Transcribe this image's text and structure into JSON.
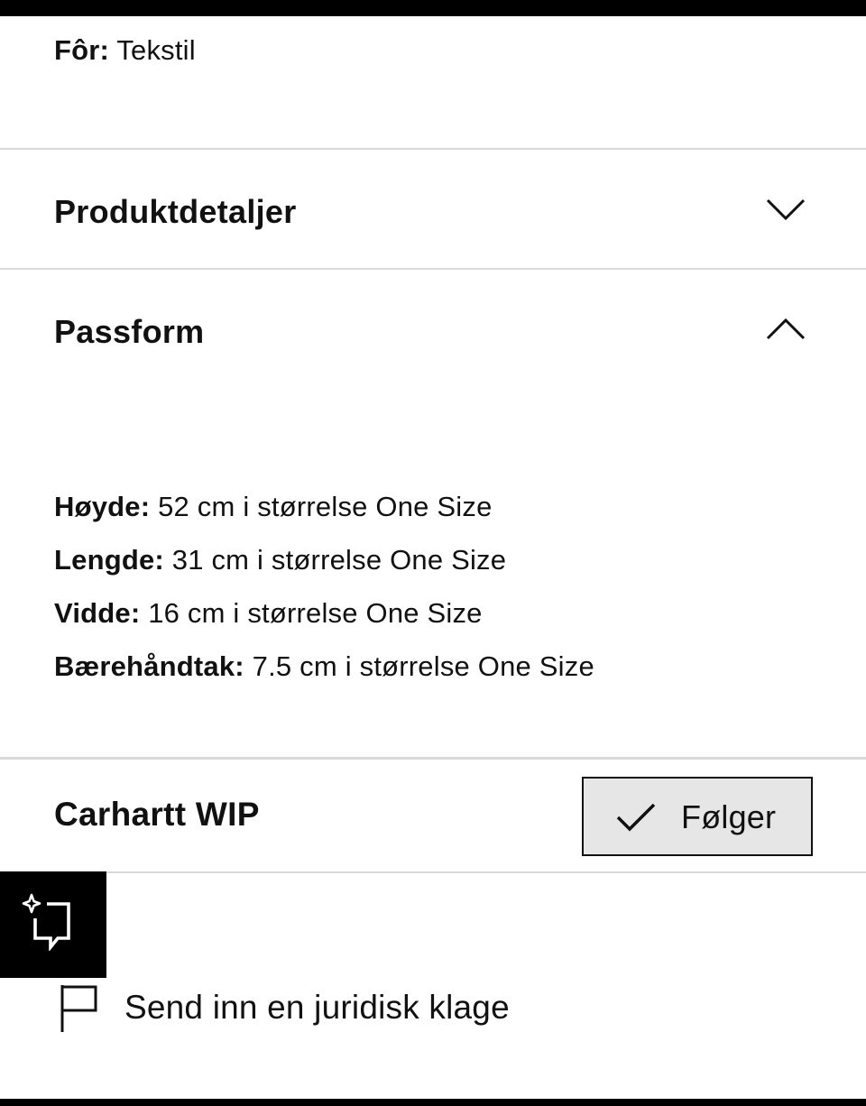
{
  "material": {
    "label": "Fôr:",
    "value": "Tekstil"
  },
  "accordion": {
    "product_details": {
      "title": "Produktdetaljer",
      "state": "collapsed",
      "icon": "chevron-down-icon"
    },
    "fit": {
      "title": "Passform",
      "state": "expanded",
      "icon": "chevron-up-icon"
    }
  },
  "fit_details": [
    {
      "label": "Høyde:",
      "value": "52 cm i størrelse One Size"
    },
    {
      "label": "Lengde:",
      "value": "31 cm i størrelse One Size"
    },
    {
      "label": "Vidde:",
      "value": "16 cm i størrelse One Size"
    },
    {
      "label": "Bærehåndtak:",
      "value": "7.5 cm i størrelse One Size"
    }
  ],
  "brand": {
    "name": "Carhartt WIP",
    "follow_label": "Følger",
    "follow_icon": "checkmark-icon"
  },
  "ai_assistant": {
    "icon": "sparkle-chat-icon"
  },
  "legal": {
    "label": "Send inn en juridisk klage",
    "icon": "flag-icon"
  }
}
